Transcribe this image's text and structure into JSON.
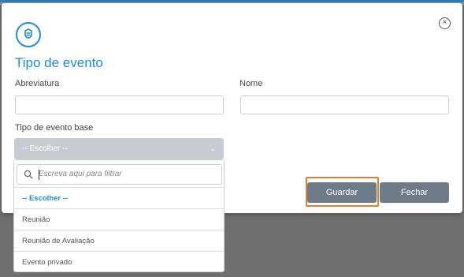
{
  "modal": {
    "title": "Tipo de evento",
    "close_icon": "close-circle-icon",
    "logo_icon": "app-logo-icon"
  },
  "form": {
    "abbr_label": "Abreviatura",
    "abbr_value": "",
    "name_label": "Nome",
    "name_value": "",
    "base_label": "Tipo de evento base",
    "base_selected": "-- Escolher --"
  },
  "dropdown": {
    "search_placeholder": "Escreva aqui para filtrar",
    "options": [
      "-- Escolher --",
      "Reunião",
      "Reunião de Avaliação",
      "Evento privado"
    ]
  },
  "buttons": {
    "save": "Guardar",
    "close": "Fechar"
  },
  "colors": {
    "accent": "#1a8fd1",
    "button": "#6e7b88",
    "focus": "#e0802a"
  }
}
